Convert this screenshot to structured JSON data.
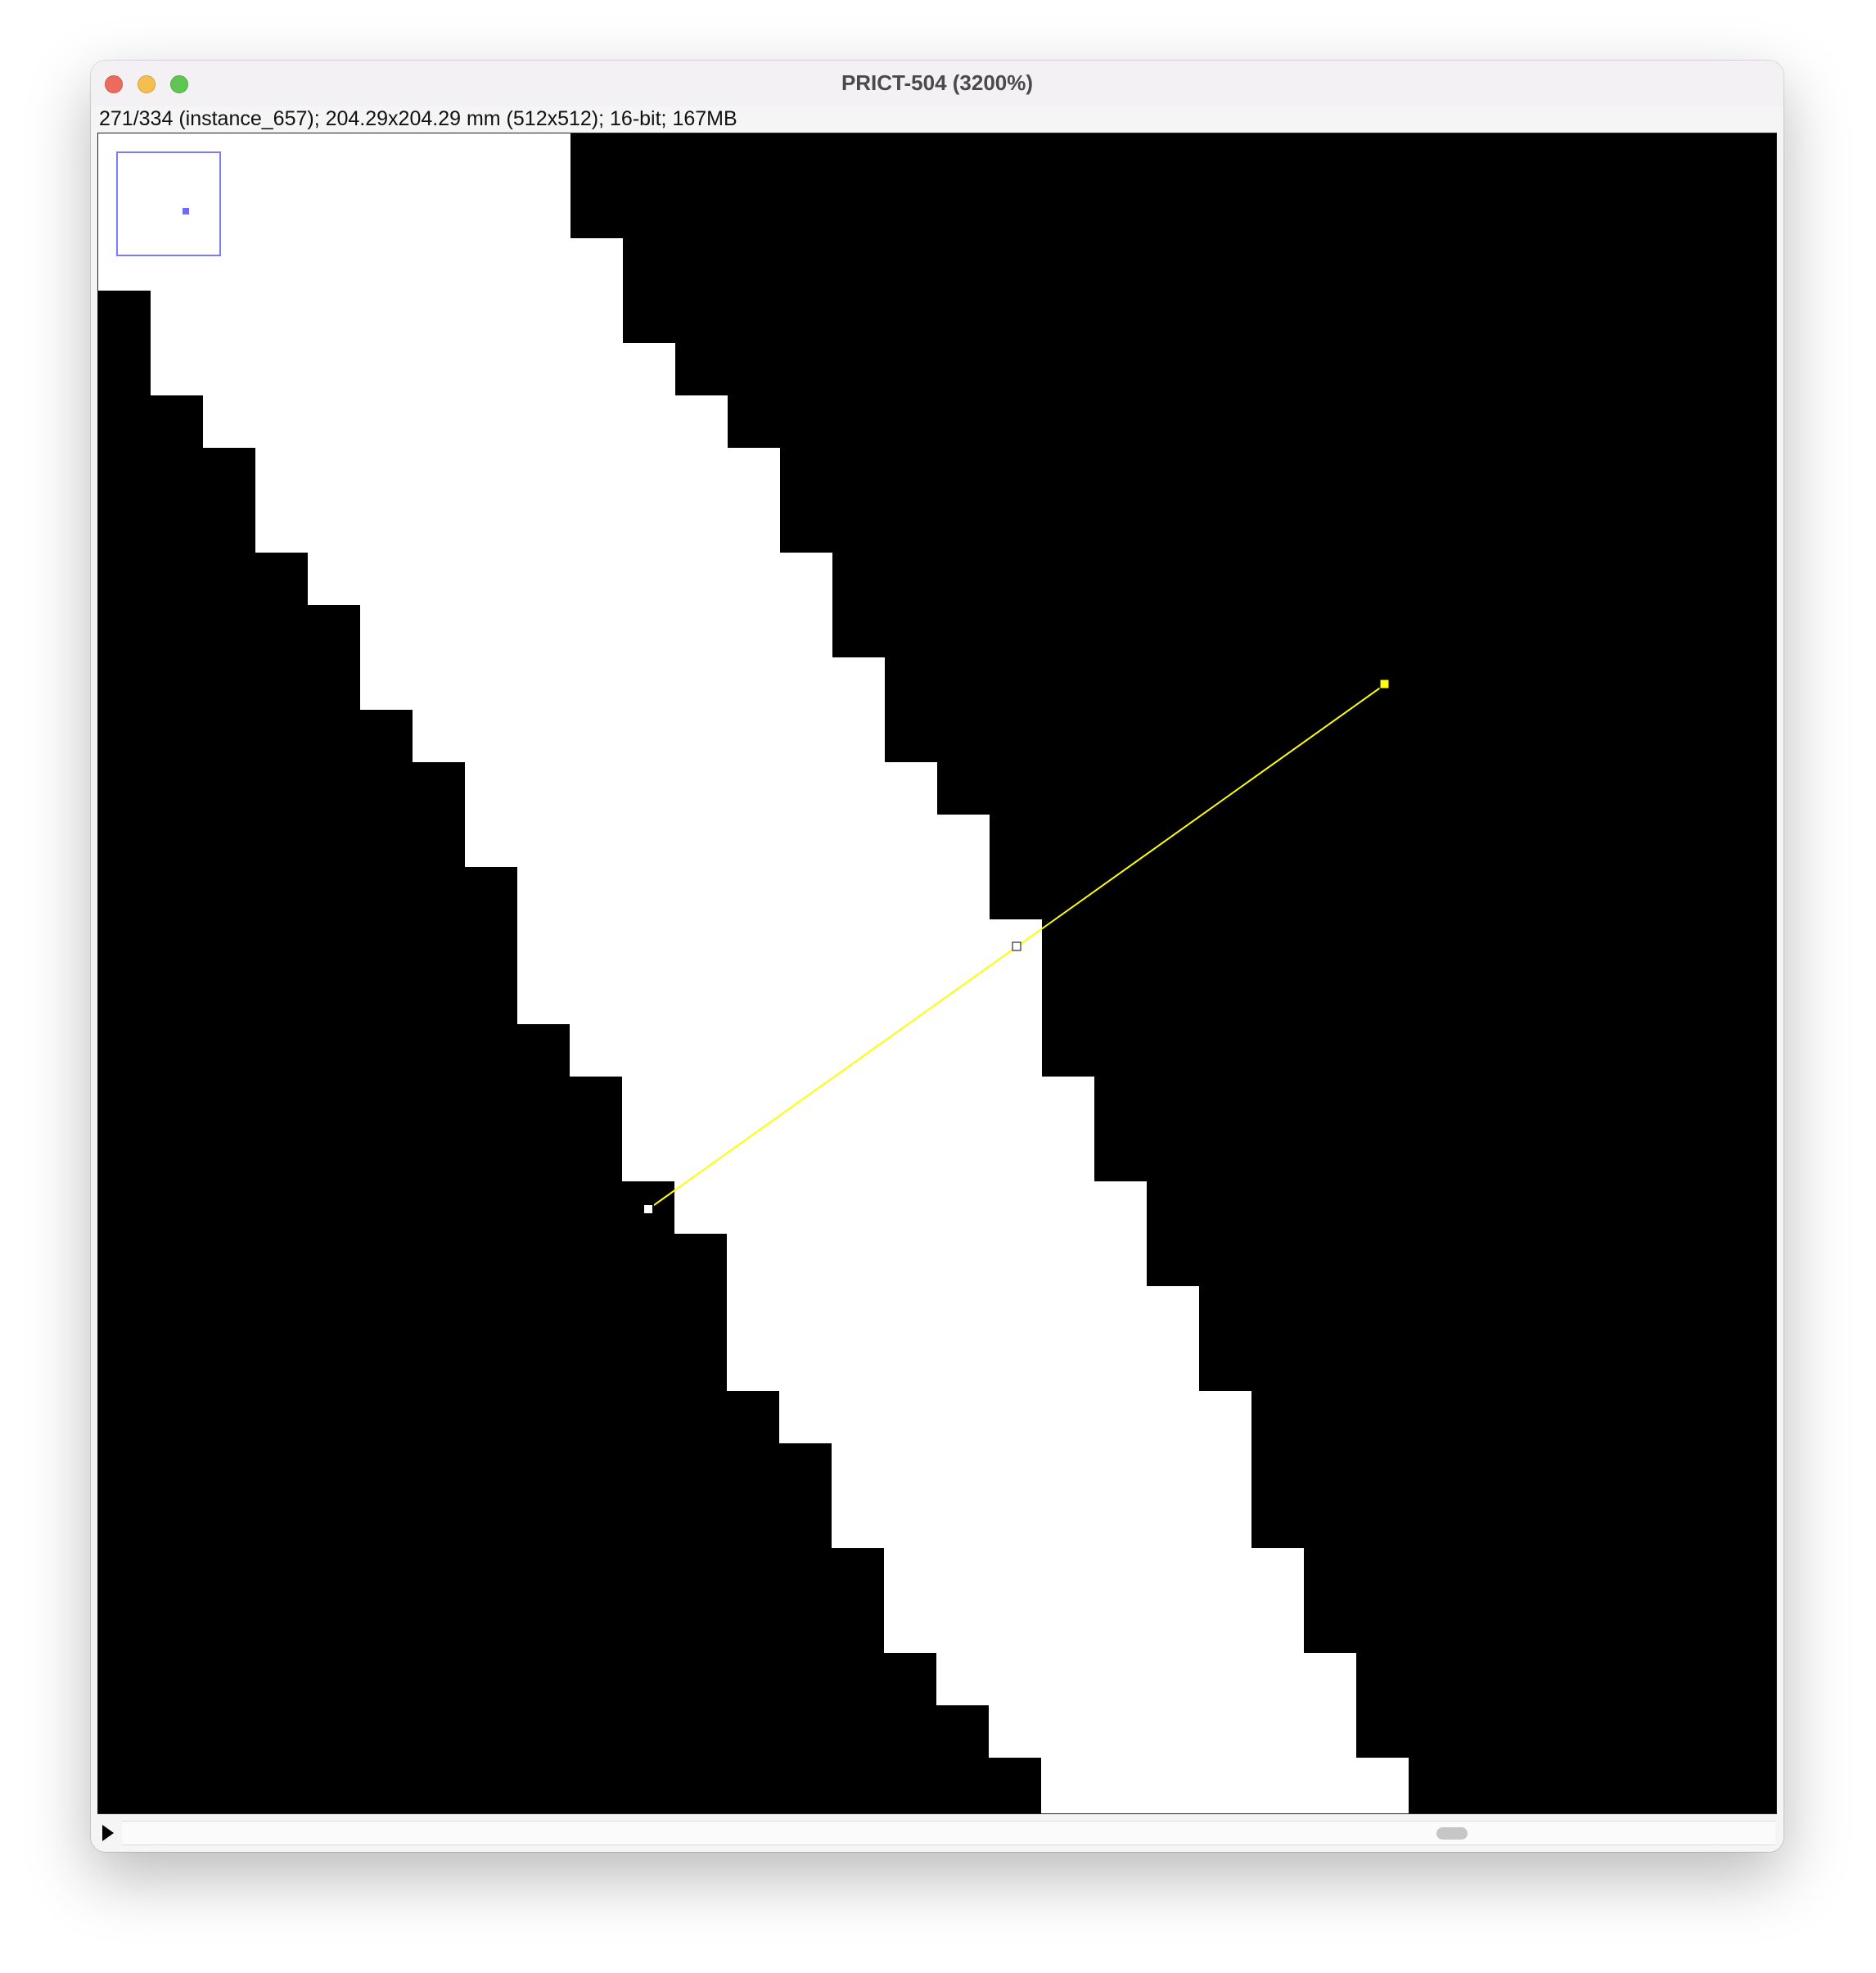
{
  "window": {
    "title": "PRICT-504 (3200%)",
    "info": "271/334 (instance_657); 204.29x204.29 mm (512x512); 16-bit; 167MB"
  },
  "traffic_lights": {
    "close": "close-button",
    "minimize": "minimize-button",
    "zoom": "zoom-button"
  },
  "image": {
    "slice_index": 271,
    "slice_count": 334,
    "zoom_percent": 3200,
    "foreground_color": "#ffffff",
    "background_color": "#000000",
    "roi_color": "#ffff00",
    "navigator_color": "#7b7bff"
  },
  "bottom": {
    "play_icon": "play-icon",
    "slice_progress": 0.81
  }
}
